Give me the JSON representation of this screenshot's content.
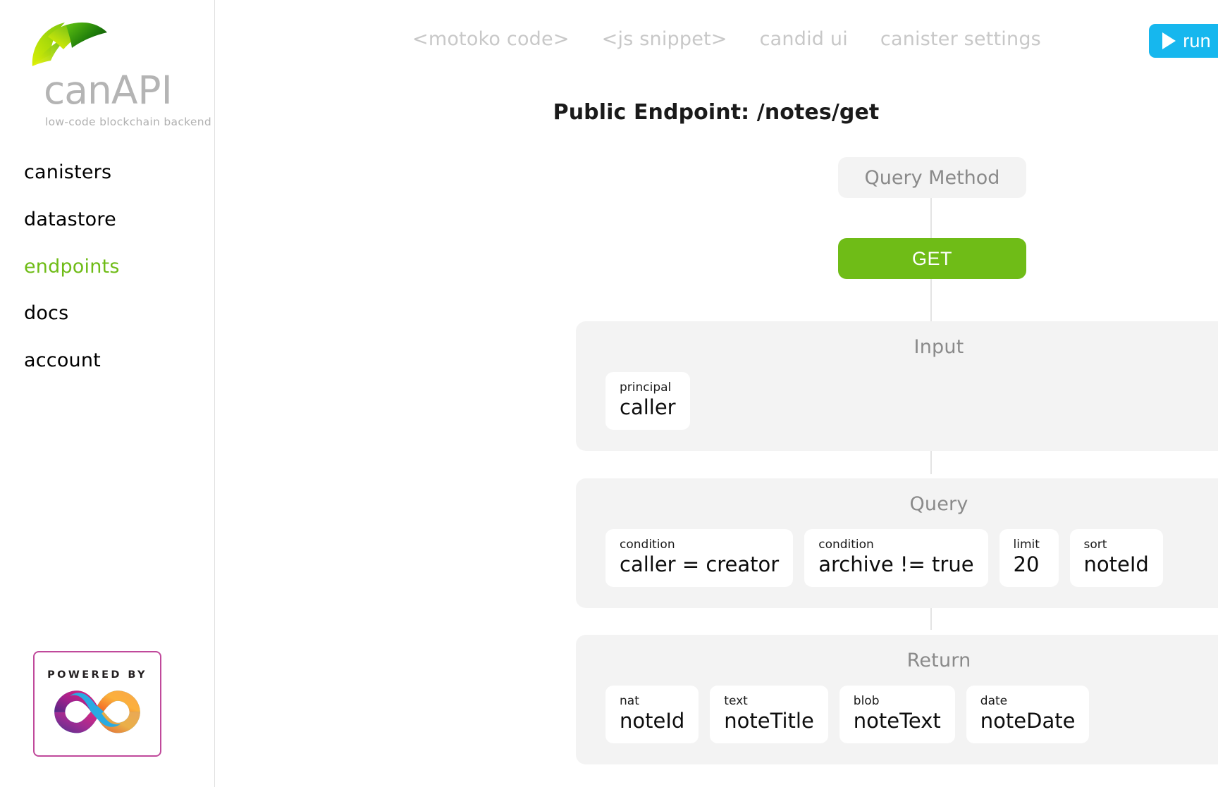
{
  "brand": {
    "name_part1": "can",
    "name_part2": "API",
    "tagline": "low-code blockchain backend",
    "logo_icon": "leaf-logo-icon",
    "accent_green": "#6fbc17",
    "text_gray": "#b4b4b4"
  },
  "sidebar": {
    "items": [
      {
        "label": "canisters",
        "active": false
      },
      {
        "label": "datastore",
        "active": false
      },
      {
        "label": "endpoints",
        "active": true
      },
      {
        "label": "docs",
        "active": false
      },
      {
        "label": "account",
        "active": false
      }
    ],
    "powered_by": {
      "label": "POWERED BY",
      "logo_icon": "internet-computer-infinity-icon"
    }
  },
  "topnav": {
    "tabs": [
      {
        "label": "<motoko code>"
      },
      {
        "label": "<js snippet>"
      },
      {
        "label": "candid ui"
      },
      {
        "label": "canister settings"
      }
    ],
    "run_button": {
      "label": "run",
      "icon": "play-icon",
      "color": "#16b7ee"
    }
  },
  "page": {
    "title": "Public Endpoint: /notes/get",
    "query_method": {
      "label": "Query Method"
    },
    "http_method": {
      "label": "GET",
      "color": "#6fbc17"
    }
  },
  "sections": [
    {
      "title": "Input",
      "add_label": "+",
      "chips": [
        {
          "type": "principal",
          "value": "caller"
        }
      ]
    },
    {
      "title": "Query",
      "add_label": "+",
      "chips": [
        {
          "type": "condition",
          "value": "caller = creator"
        },
        {
          "type": "condition",
          "value": "archive != true"
        },
        {
          "type": "limit",
          "value": "20"
        },
        {
          "type": "sort",
          "value": "noteId"
        }
      ]
    },
    {
      "title": "Return",
      "add_label": "+",
      "chips": [
        {
          "type": "nat",
          "value": "noteId"
        },
        {
          "type": "text",
          "value": "noteTitle"
        },
        {
          "type": "blob",
          "value": "noteText"
        },
        {
          "type": "date",
          "value": "noteDate"
        }
      ]
    }
  ]
}
